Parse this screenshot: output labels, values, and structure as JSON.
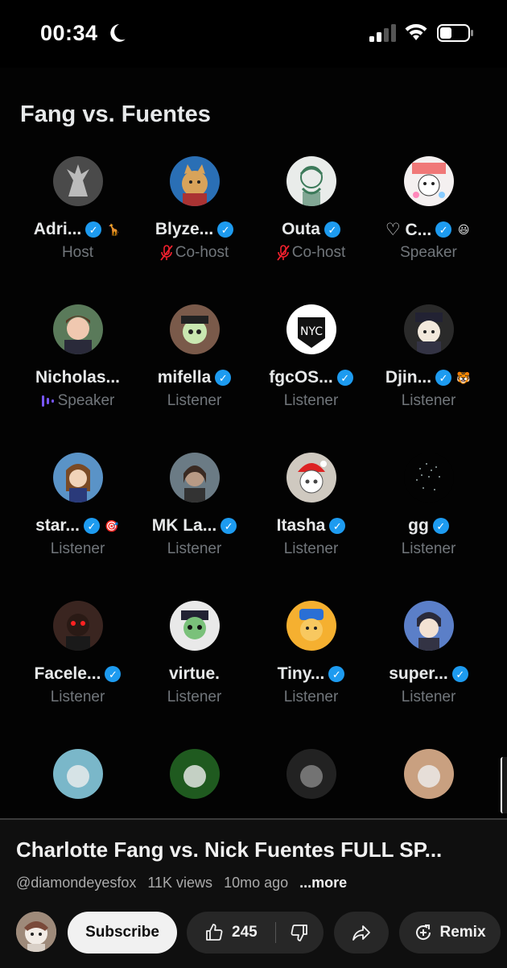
{
  "status_bar": {
    "time": "00:34",
    "icons": [
      "moon-icon",
      "signal-icon",
      "wifi-icon",
      "battery-icon"
    ]
  },
  "space": {
    "title": "Fang vs. Fuentes",
    "participants": [
      {
        "name": "Adri...",
        "verified": true,
        "badge": "🦒",
        "role": "Host",
        "muted": false,
        "speaking": false
      },
      {
        "name": "Blyze...",
        "verified": true,
        "badge": "",
        "role": "Co-host",
        "muted": true,
        "speaking": false
      },
      {
        "name": "Outa",
        "verified": true,
        "badge": "",
        "role": "Co-host",
        "muted": true,
        "speaking": false
      },
      {
        "name": "♡ C...",
        "verified": true,
        "badge": "😃",
        "role": "Speaker",
        "muted": false,
        "speaking": false
      },
      {
        "name": "Nicholas...",
        "verified": false,
        "badge": "",
        "role": "Speaker",
        "muted": false,
        "speaking": true
      },
      {
        "name": "mifella",
        "verified": true,
        "badge": "",
        "role": "Listener",
        "muted": false,
        "speaking": false
      },
      {
        "name": "fgcOS...",
        "verified": true,
        "badge": "",
        "role": "Listener",
        "muted": false,
        "speaking": false
      },
      {
        "name": "Djin...",
        "verified": true,
        "badge": "🐯",
        "role": "Listener",
        "muted": false,
        "speaking": false
      },
      {
        "name": "star...",
        "verified": true,
        "badge": "🎯",
        "role": "Listener",
        "muted": false,
        "speaking": false
      },
      {
        "name": "MK La...",
        "verified": true,
        "badge": "",
        "role": "Listener",
        "muted": false,
        "speaking": false
      },
      {
        "name": "Itasha",
        "verified": true,
        "badge": "",
        "role": "Listener",
        "muted": false,
        "speaking": false
      },
      {
        "name": "gg",
        "verified": true,
        "badge": "",
        "role": "Listener",
        "muted": false,
        "speaking": false
      },
      {
        "name": "Facele...",
        "verified": true,
        "badge": "",
        "role": "Listener",
        "muted": false,
        "speaking": false
      },
      {
        "name": "virtue.",
        "verified": false,
        "badge": "",
        "role": "Listener",
        "muted": false,
        "speaking": false
      },
      {
        "name": "Tiny...",
        "verified": true,
        "badge": "",
        "role": "Listener",
        "muted": false,
        "speaking": false
      },
      {
        "name": "super...",
        "verified": true,
        "badge": "",
        "role": "Listener",
        "muted": false,
        "speaking": false
      }
    ]
  },
  "video": {
    "title": "Charlotte Fang vs. Nick Fuentes FULL SP...",
    "channel": "@diamondeyesfox",
    "views": "11K views",
    "age": "10mo ago",
    "more_label": "...more",
    "subscribe_label": "Subscribe",
    "like_count": "245",
    "remix_label": "Remix"
  },
  "colors": {
    "background": "#000000",
    "verified_blue": "#1d9bf0",
    "muted_red": "#f4212e",
    "speaking_purple": "#7856ff",
    "secondary_text": "#71767b",
    "pill_bg": "#272727"
  }
}
